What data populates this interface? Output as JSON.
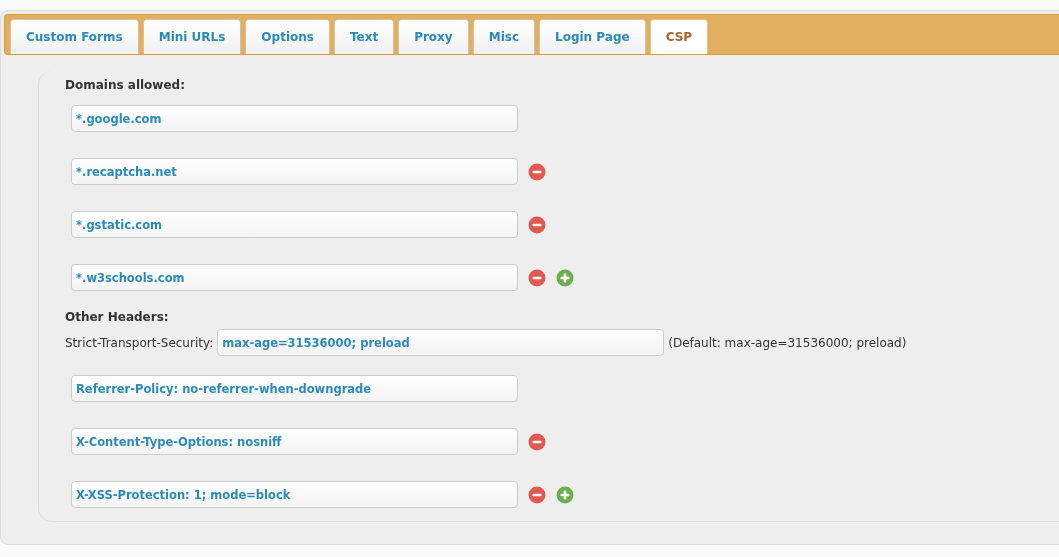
{
  "tabs": [
    {
      "label": "Custom Forms",
      "selected": false
    },
    {
      "label": "Mini URLs",
      "selected": false
    },
    {
      "label": "Options",
      "selected": false
    },
    {
      "label": "Text",
      "selected": false
    },
    {
      "label": "Proxy",
      "selected": false
    },
    {
      "label": "Misc",
      "selected": false
    },
    {
      "label": "Login Page",
      "selected": false
    },
    {
      "label": "CSP",
      "selected": true
    }
  ],
  "domains": {
    "heading": "Domains allowed:",
    "rows": [
      {
        "value": "*.google.com",
        "removable": false,
        "addable": false
      },
      {
        "value": "*.recaptcha.net",
        "removable": true,
        "addable": false
      },
      {
        "value": "*.gstatic.com",
        "removable": true,
        "addable": false
      },
      {
        "value": "*.w3schools.com",
        "removable": true,
        "addable": true
      }
    ]
  },
  "other_headers": {
    "heading": "Other Headers:",
    "strict_transport_security": {
      "label": "Strict-Transport-Security:",
      "value": "max-age=31536000; preload",
      "default_note": "(Default: max-age=31536000; preload)"
    },
    "rows": [
      {
        "value": "Referrer-Policy: no-referrer-when-downgrade",
        "removable": false,
        "addable": false
      },
      {
        "value": "X-Content-Type-Options: nosniff",
        "removable": true,
        "addable": false
      },
      {
        "value": "X-XSS-Protection: 1; mode=block",
        "removable": true,
        "addable": true
      }
    ]
  }
}
